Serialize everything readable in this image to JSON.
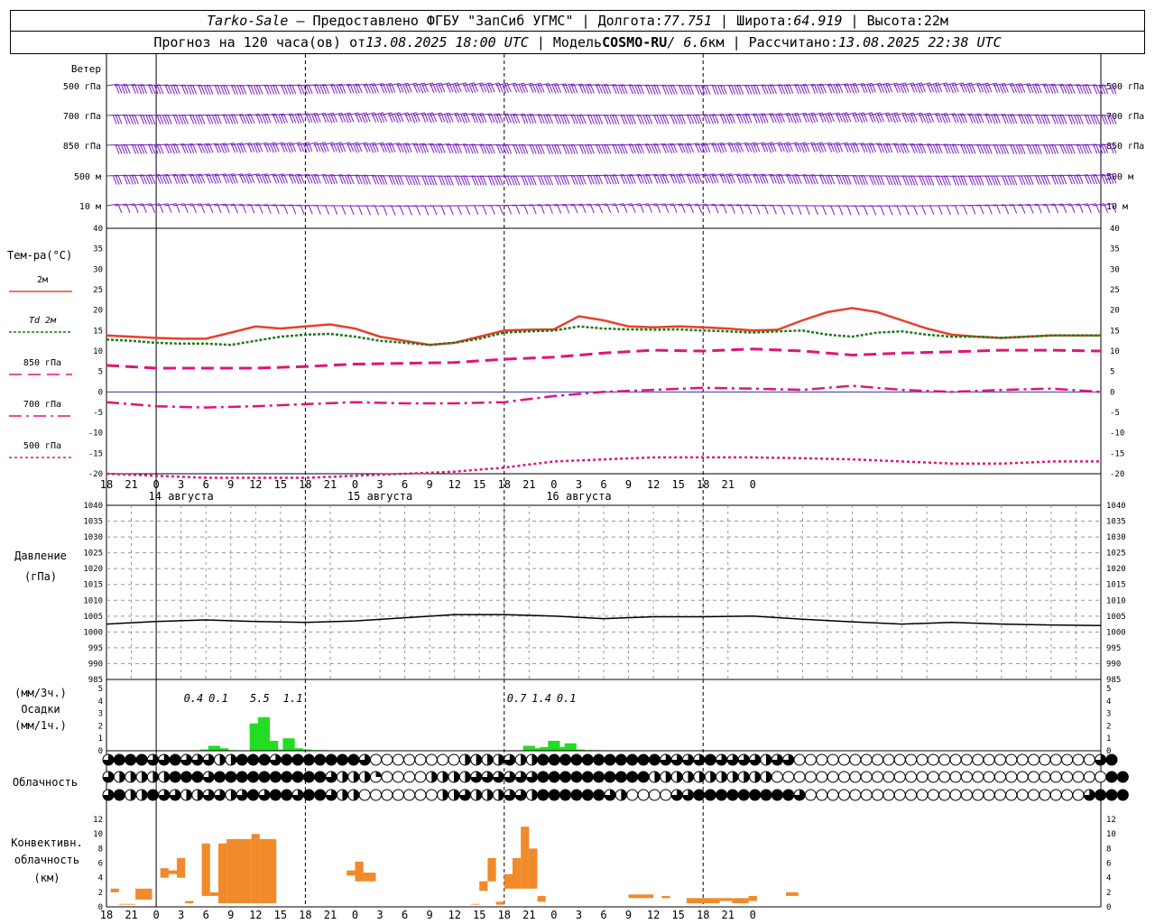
{
  "header": {
    "station": "Tarko-Sale",
    "dash": " – ",
    "provider": "Предоставлено ФГБУ \"ЗапСиб УГМС\"",
    "lon_label": "Долгота:",
    "lon": "77.751",
    "lat_label": "Широта:",
    "lat": "64.919",
    "alt_label": "Высота:",
    "alt": "22м",
    "sep": " | ",
    "forecast_label": "Прогноз на 120 часа(ов) от",
    "forecast_from": "13.08.2025 18:00 UTC",
    "model_label": "Модель",
    "model_name": "COSMO-RU",
    "model_res": "/ 6.6",
    "model_res_unit": "км",
    "calc_label": "Рассчитано:",
    "calc_time": "13.08.2025 22:38 UTC"
  },
  "colors": {
    "wind": "#7a1fc8",
    "t2m": "#e8402a",
    "td2m": "#1a7a1a",
    "t850": "#e0157a",
    "t700": "#e0157a",
    "t500": "#e0157a",
    "zero_line": "#3030c0",
    "precip": "#22dd22",
    "conv_cloud": "#f08a2a",
    "grid": "#999999",
    "pressure": "#000000"
  },
  "time_axis": {
    "hours": [
      18,
      21,
      0,
      3,
      6,
      9,
      12,
      15,
      18,
      21,
      0,
      3,
      6,
      9,
      12,
      15,
      18,
      21,
      0,
      3,
      6,
      9,
      12,
      15,
      18,
      21,
      0
    ],
    "day_labels": [
      {
        "text": "14 августа",
        "at": 9
      },
      {
        "text": "15 августа",
        "at": 33
      },
      {
        "text": "16 августа",
        "at": 57
      }
    ]
  },
  "chart_data": [
    {
      "type": "wind_barbs",
      "panel_label": "Ветер",
      "levels": [
        "500 гПа",
        "700 гПа",
        "850 гПа",
        "500 м",
        "10   м"
      ]
    },
    {
      "type": "line",
      "panel_label": "Тем-ра(°C)",
      "ylim": [
        -20,
        40
      ],
      "yticks": [
        -20,
        -15,
        -10,
        -5,
        0,
        5,
        10,
        15,
        20,
        25,
        30,
        35,
        40
      ],
      "x_unit": "hours_from_start",
      "series": [
        {
          "name": "2м",
          "style": "solid",
          "color_key": "t2m",
          "x": [
            0,
            3,
            6,
            9,
            12,
            15,
            18,
            21,
            24,
            27,
            30,
            33,
            36,
            39,
            42,
            45,
            48,
            51,
            54,
            57,
            60,
            63,
            66,
            69,
            72,
            75,
            78,
            81,
            84,
            87,
            90,
            93,
            96,
            99,
            102,
            105,
            108,
            111,
            114,
            117,
            120
          ],
          "y": [
            13.8,
            13.5,
            13.2,
            13.0,
            13.0,
            14.5,
            16.0,
            15.5,
            16.0,
            16.5,
            15.5,
            13.5,
            12.5,
            11.5,
            12.0,
            13.5,
            15.0,
            15.2,
            15.3,
            18.5,
            17.5,
            16.0,
            15.8,
            16.0,
            15.8,
            15.5,
            15.0,
            15.2,
            17.5,
            19.5,
            20.5,
            19.5,
            17.5,
            15.5,
            14.0,
            13.5,
            13.2,
            13.5,
            13.8,
            13.8,
            13.8
          ]
        },
        {
          "name": "Td  2м",
          "style": "dotted",
          "color_key": "td2m",
          "x": [
            0,
            3,
            6,
            9,
            12,
            15,
            18,
            21,
            24,
            27,
            30,
            33,
            36,
            39,
            42,
            45,
            48,
            51,
            54,
            57,
            60,
            63,
            66,
            69,
            72,
            75,
            78,
            81,
            84,
            87,
            90,
            93,
            96,
            99,
            102,
            105,
            108,
            111,
            114,
            117,
            120
          ],
          "y": [
            12.8,
            12.5,
            12.0,
            11.8,
            11.8,
            11.5,
            12.5,
            13.5,
            14.0,
            14.2,
            13.5,
            12.5,
            12.0,
            11.5,
            12.0,
            13.0,
            14.5,
            14.8,
            15.0,
            16.0,
            15.5,
            15.3,
            15.2,
            15.3,
            15.0,
            14.8,
            14.5,
            14.8,
            15.0,
            14.0,
            13.5,
            14.5,
            14.8,
            14.0,
            13.5,
            13.5,
            13.2,
            13.5,
            13.8,
            13.8,
            13.8
          ]
        },
        {
          "name": "850 гПа",
          "style": "dashed",
          "color_key": "t850",
          "x": [
            0,
            6,
            12,
            18,
            24,
            30,
            36,
            42,
            48,
            54,
            60,
            66,
            72,
            78,
            84,
            90,
            96,
            102,
            108,
            114,
            120
          ],
          "y": [
            6.5,
            5.8,
            5.8,
            5.8,
            6.2,
            6.8,
            7.0,
            7.2,
            8.0,
            8.5,
            9.5,
            10.2,
            10.0,
            10.5,
            10.0,
            9.0,
            9.5,
            9.8,
            10.2,
            10.2,
            10.0
          ]
        },
        {
          "name": "700 гПа",
          "style": "dashdot",
          "color_key": "t700",
          "x": [
            0,
            6,
            12,
            18,
            24,
            30,
            36,
            42,
            48,
            54,
            60,
            66,
            72,
            78,
            84,
            90,
            96,
            102,
            108,
            114,
            120
          ],
          "y": [
            -2.5,
            -3.5,
            -3.8,
            -3.5,
            -3.0,
            -2.5,
            -2.8,
            -2.8,
            -2.5,
            -1.0,
            0.0,
            0.5,
            1.0,
            0.8,
            0.5,
            1.5,
            0.5,
            0.0,
            0.5,
            0.8,
            0.0
          ]
        },
        {
          "name": "500 гПа",
          "style": "dotted_fine",
          "color_key": "t500",
          "x": [
            0,
            12,
            24,
            36,
            42,
            48,
            54,
            60,
            66,
            72,
            78,
            84,
            90,
            96,
            102,
            108,
            114,
            120
          ],
          "y": [
            -20,
            -21,
            -21,
            -20.0,
            -19.5,
            -18.5,
            -17.0,
            -16.5,
            -16.0,
            -16.0,
            -16.0,
            -16.2,
            -16.5,
            -17.0,
            -17.5,
            -17.5,
            -17.0,
            -17.0
          ]
        }
      ]
    },
    {
      "type": "line",
      "panel_label": "Давление",
      "panel_unit": "(гПа)",
      "ylim": [
        985,
        1040
      ],
      "yticks": [
        985,
        990,
        995,
        1000,
        1005,
        1010,
        1015,
        1020,
        1025,
        1030,
        1035,
        1040
      ],
      "series": [
        {
          "name": "",
          "x": [
            0,
            6,
            12,
            18,
            24,
            30,
            36,
            42,
            48,
            54,
            60,
            66,
            72,
            78,
            84,
            90,
            96,
            102,
            108,
            114,
            120
          ],
          "y": [
            1002.5,
            1003.3,
            1003.8,
            1003.3,
            1003.0,
            1003.5,
            1004.5,
            1005.5,
            1005.5,
            1005.0,
            1004.2,
            1004.8,
            1004.8,
            1005.0,
            1004.0,
            1003.2,
            1002.5,
            1003.0,
            1002.5,
            1002.2,
            1002.0
          ]
        }
      ]
    },
    {
      "type": "bar",
      "panel_label": "(мм/3ч.)",
      "panel_label2": "Осадки",
      "panel_label3": "(мм/1ч.)",
      "ylim": [
        0,
        5
      ],
      "yticks": [
        0,
        1,
        2,
        3,
        4,
        5
      ],
      "x": [
        12,
        13,
        14,
        15,
        18,
        19,
        20,
        21,
        22,
        23,
        24,
        25,
        26,
        51,
        52,
        53,
        54,
        55,
        56,
        57,
        58,
        59
      ],
      "values": [
        0.1,
        0.4,
        0.2,
        0.05,
        2.2,
        2.7,
        0.8,
        0.1,
        1.0,
        0.2,
        0.1,
        0.05,
        0.05,
        0.4,
        0.2,
        0.3,
        0.8,
        0.3,
        0.6,
        0.1,
        0.05,
        0.05
      ],
      "totals": [
        {
          "text": "0.4",
          "at": 10.5
        },
        {
          "text": "0.1",
          "at": 13.5
        },
        {
          "text": "5.5",
          "at": 18.5
        },
        {
          "text": "1.1",
          "at": 22.5
        },
        {
          "text": "0.7",
          "at": 49.5
        },
        {
          "text": "1.4",
          "at": 52.5
        },
        {
          "text": "0.1",
          "at": 55.5
        }
      ]
    },
    {
      "type": "cloud_symbols",
      "panel_label": "Облачность",
      "rows": 3,
      "cover_levels": [
        "0.75,1,1,1,0.75,0.75,1,0.75,0.75,0.75,0.5,0.5,1,1,1,0.75,1,1,1,1,1,1,1,0.75,0,0,0,0,0,0,0,0,0.5,0.5,0.5,0.5,0.75,0.5,0.5,1,1,1,1,1,1,1,1,1,1,1,0.75,0.75,0.75,0.75,1,0.75,0.75,0.75,0.75,0.5,0.75,0.75,0,0,0,0,0,0,0,0,0,0,0,0,0,0,0,0,0,0,0,0,0,0,0,0,0,0,0,0.75,1",
        "0.75,0.5,0.5,0.5,0.5,0.5,1,1,1,0.75,1,1,1,1,1,1,1,1,1,1,0.75,0.5,0.5,0.5,0.25,0,0,0,0,0.5,0.5,0.5,0.5,0.75,0.75,0.75,0.75,0.75,0.75,1,1,1,1,1,1,1,1,1,1,0.5,0.5,0.5,0.5,0.5,0.5,0.5,0.5,0.5,0.5,0.5,0,0,0,0,0,0,0,0,0,0,0,0,0,0,0,0,0,0,0,0,0,0,0,0,0,0,0,0,0,0,1,1",
        "0.75,1,0.5,0.5,1,0.75,0.75,0.5,0.5,0.75,0.75,0.5,0.75,1,0.75,1,1,0.75,1,1,0.75,0.5,0.5,0,0,0,0,0,0,0,0.5,0.5,0.75,0.5,0.5,0.5,0.75,0.75,0.5,1,1,1,1,1,1,0.75,0.5,0,0,0,0,0.75,0.75,1,1,1,1,1,1,1,1,1,0.75,0,0,0,0,0,0,0,0,0,0,0,0,0,0,0,0,0,0,0,0,0,0,0,0,0,0.75,1,1,1"
      ]
    },
    {
      "type": "bar",
      "panel_label": "Конвективн.",
      "panel_label2": "облачность",
      "panel_label3": "(км)",
      "ylim": [
        0,
        13
      ],
      "yticks": [
        0,
        2,
        4,
        6,
        8,
        10,
        12
      ],
      "bars": [
        {
          "x0": 0.5,
          "x1": 1.5,
          "b": 2.0,
          "t": 2.5
        },
        {
          "x0": 1.5,
          "x1": 3.5,
          "b": 0.3,
          "t": 0.4
        },
        {
          "x0": 3.5,
          "x1": 5.5,
          "b": 1.0,
          "t": 2.5
        },
        {
          "x0": 6.5,
          "x1": 7.5,
          "b": 4.0,
          "t": 5.3
        },
        {
          "x0": 7.5,
          "x1": 8.5,
          "b": 4.5,
          "t": 5.0
        },
        {
          "x0": 8.5,
          "x1": 9.5,
          "b": 4.0,
          "t": 6.7
        },
        {
          "x0": 9.5,
          "x1": 10.5,
          "b": 0.5,
          "t": 0.8
        },
        {
          "x0": 11.5,
          "x1": 12.5,
          "b": 1.5,
          "t": 8.7
        },
        {
          "x0": 12.5,
          "x1": 13.5,
          "b": 1.5,
          "t": 2.0
        },
        {
          "x0": 13.5,
          "x1": 14.5,
          "b": 0.5,
          "t": 8.7
        },
        {
          "x0": 14.5,
          "x1": 17.5,
          "b": 0.5,
          "t": 9.3
        },
        {
          "x0": 17.5,
          "x1": 18.5,
          "b": 0.5,
          "t": 10.0
        },
        {
          "x0": 18.5,
          "x1": 20.5,
          "b": 0.5,
          "t": 9.3
        },
        {
          "x0": 29.0,
          "x1": 30.0,
          "b": 4.3,
          "t": 5.0
        },
        {
          "x0": 30.0,
          "x1": 31.0,
          "b": 3.5,
          "t": 6.2
        },
        {
          "x0": 31.0,
          "x1": 32.5,
          "b": 3.5,
          "t": 4.7
        },
        {
          "x0": 44.0,
          "x1": 45.0,
          "b": 0.3,
          "t": 0.4
        },
        {
          "x0": 45.0,
          "x1": 46.0,
          "b": 2.2,
          "t": 3.5
        },
        {
          "x0": 46.0,
          "x1": 47.0,
          "b": 3.5,
          "t": 6.7
        },
        {
          "x0": 47.0,
          "x1": 48.0,
          "b": 0.3,
          "t": 0.7
        },
        {
          "x0": 48.0,
          "x1": 49.0,
          "b": 2.5,
          "t": 4.5
        },
        {
          "x0": 49.0,
          "x1": 50.0,
          "b": 2.5,
          "t": 6.7
        },
        {
          "x0": 50.0,
          "x1": 51.0,
          "b": 2.5,
          "t": 11.0
        },
        {
          "x0": 51.0,
          "x1": 52.0,
          "b": 2.5,
          "t": 8.0
        },
        {
          "x0": 52.0,
          "x1": 53.0,
          "b": 0.7,
          "t": 1.5
        },
        {
          "x0": 63.0,
          "x1": 66.0,
          "b": 1.2,
          "t": 1.7
        },
        {
          "x0": 67.0,
          "x1": 68.0,
          "b": 1.2,
          "t": 1.5
        },
        {
          "x0": 70.0,
          "x1": 74.0,
          "b": 0.5,
          "t": 1.2
        },
        {
          "x0": 74.0,
          "x1": 75.5,
          "b": 0.8,
          "t": 1.2
        },
        {
          "x0": 75.5,
          "x1": 77.5,
          "b": 0.5,
          "t": 1.2
        },
        {
          "x0": 77.5,
          "x1": 78.5,
          "b": 0.8,
          "t": 1.5
        },
        {
          "x0": 82.0,
          "x1": 83.5,
          "b": 1.5,
          "t": 2.0
        }
      ]
    }
  ]
}
